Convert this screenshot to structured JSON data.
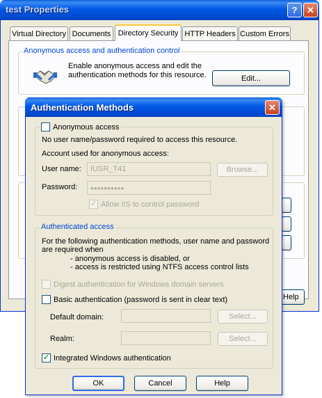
{
  "properties_window": {
    "title": "test Properties",
    "help_glyph": "?",
    "close_glyph": "✕",
    "tabs": [
      {
        "label": "Virtual Directory"
      },
      {
        "label": "Documents"
      },
      {
        "label": "Directory Security"
      },
      {
        "label": "HTTP Headers"
      },
      {
        "label": "Custom Errors"
      }
    ],
    "active_tab": "Directory Security",
    "anon_group_label": "Anonymous access and authentication control",
    "anon_group_text_1": "Enable anonymous access and edit the",
    "anon_group_text_2": "authentication methods for this resource.",
    "edit_button": "Edit...",
    "help_button": "Help",
    "icon": "handshake-icon"
  },
  "auth_dialog": {
    "title": "Authentication Methods",
    "close_glyph": "✕",
    "anonymous_access_label": "Anonymous access",
    "anonymous_access_checked": false,
    "no_user_text": "No user name/password required to access this resource.",
    "account_used_text": "Account used for anonymous access:",
    "user_name_label": "User name:",
    "user_name_value": "IUSR_T41",
    "browse_button": "Browse...",
    "password_label": "Password:",
    "password_value": "●●●●●●●●●●",
    "allow_iis_label": "Allow IIS to control password",
    "allow_iis_checked": true,
    "authenticated_access_label": "Authenticated access",
    "auth_desc_1": "For the following authentication methods, user name and password",
    "auth_desc_2": "are required when",
    "auth_bullet_1": "- anonymous access is disabled, or",
    "auth_bullet_2": "- access is restricted using NTFS access control lists",
    "digest_label": "Digest authentication for Windows domain servers",
    "digest_checked": false,
    "basic_label": "Basic authentication (password is sent in clear text)",
    "basic_checked": false,
    "default_domain_label": "Default domain:",
    "default_domain_value": "",
    "select_button_1": "Select...",
    "realm_label": "Realm:",
    "realm_value": "",
    "select_button_2": "Select...",
    "integrated_label": "Integrated Windows authentication",
    "integrated_checked": true,
    "check_glyph": "✓",
    "ok_button": "OK",
    "cancel_button": "Cancel",
    "help_button": "Help"
  },
  "colors": {
    "titlebar_blue": "#0058e6",
    "dialog_face": "#ece9d8",
    "group_label_blue": "#0046d5",
    "close_red": "#c8421e",
    "active_tab_accent": "#ffc83c"
  }
}
